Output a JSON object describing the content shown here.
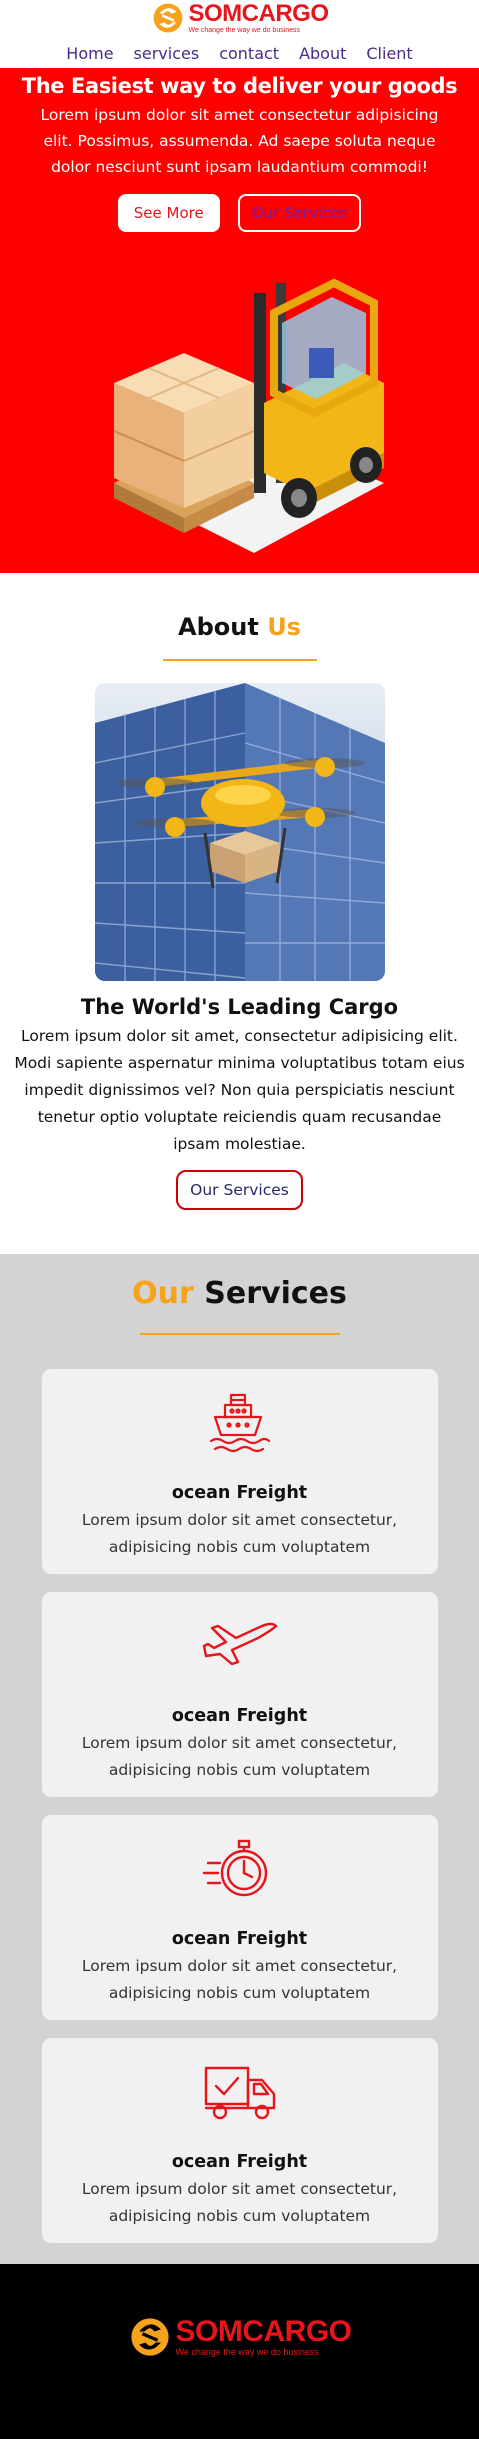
{
  "brand": {
    "name": "SOMCARGO",
    "tagline": "We change the way we do business"
  },
  "nav": [
    "Home",
    "services",
    "contact",
    "About",
    "Client"
  ],
  "hero": {
    "title": "The Easiest way to deliver your goods",
    "text": "Lorem ipsum dolor sit amet consectetur adipisicing elit. Possimus, assumenda. Ad saepe soluta neque dolor nesciunt sunt ipsam laudantium commodi!",
    "btn_primary": "See More",
    "btn_secondary": "Our Services"
  },
  "about": {
    "title_a": "About",
    "title_b": "Us",
    "heading": "The World's Leading Cargo",
    "text": "Lorem ipsum dolor sit amet, consectetur adipisicing elit. Modi sapiente aspernatur minima voluptatibus totam eius impedit dignissimos vel? Non quia perspiciatis nesciunt tenetur optio voluptate reiciendis quam recusandae ipsam molestiae.",
    "button": "Our Services"
  },
  "services": {
    "title_a": "Our",
    "title_b": "Services",
    "cards": [
      {
        "icon": "ship-icon",
        "title": "ocean Freight",
        "text": "Lorem ipsum dolor sit amet consectetur, adipisicing nobis cum voluptatem"
      },
      {
        "icon": "airplane-icon",
        "title": "ocean Freight",
        "text": "Lorem ipsum dolor sit amet consectetur, adipisicing nobis cum voluptatem"
      },
      {
        "icon": "stopwatch-icon",
        "title": "ocean Freight",
        "text": "Lorem ipsum dolor sit amet consectetur, adipisicing nobis cum voluptatem"
      },
      {
        "icon": "delivery-truck-icon",
        "title": "ocean Freight",
        "text": "Lorem ipsum dolor sit amet consectetur, adipisicing nobis cum voluptatem"
      }
    ]
  },
  "colors": {
    "brand_red": "#e8141b",
    "hero_red": "#fe0000",
    "accent_orange": "#f7a21b",
    "services_bg": "#d3d3d3",
    "footer_bg": "#000000"
  }
}
